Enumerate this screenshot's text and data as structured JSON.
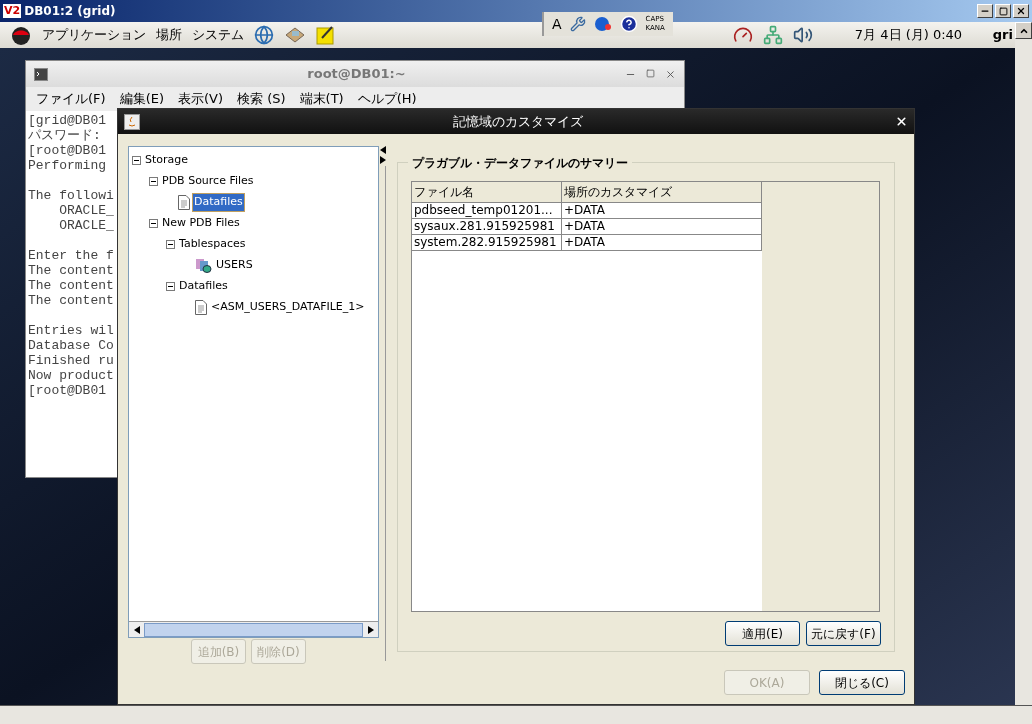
{
  "vnc_window": {
    "title": "DB01:2 (grid)",
    "logo": "V2"
  },
  "panel": {
    "menus": [
      "アプリケーション",
      "場所",
      "システム"
    ],
    "ime": {
      "letter": "A",
      "caps": "CAPS",
      "kana": "KANA"
    },
    "clock": "7月 4日 (月) 0:40",
    "user": "gri"
  },
  "terminal": {
    "title": "root@DB01:~",
    "menus": [
      "ファイル(F)",
      "編集(E)",
      "表示(V)",
      "検索 (S)",
      "端末(T)",
      "ヘルプ(H)"
    ],
    "blocks": [
      [
        "[grid@DB01",
        "パスワード:",
        "[root@DB01",
        "Performing"
      ],
      [
        "The followi",
        "    ORACLE_",
        "    ORACLE_"
      ],
      [
        "Enter the f",
        "The content",
        "The content",
        "The content"
      ],
      [
        "Entries wil",
        "Database Co",
        "Finished ru",
        "Now product",
        "[root@DB01"
      ]
    ]
  },
  "dialog": {
    "title": "記憶域のカスタマイズ",
    "tree": [
      {
        "label": "Storage",
        "expanded": true,
        "selected": false,
        "children": [
          {
            "label": "PDB Source Files",
            "expanded": true,
            "selected": false,
            "children": [
              {
                "label": "Datafiles",
                "kind": "file",
                "selected": true
              }
            ]
          },
          {
            "label": "New PDB Files",
            "expanded": true,
            "selected": false,
            "children": [
              {
                "label": "Tablespaces",
                "expanded": true,
                "selected": false,
                "children": [
                  {
                    "label": "USERS",
                    "kind": "tablespace",
                    "selected": false
                  }
                ]
              },
              {
                "label": "Datafiles",
                "expanded": true,
                "selected": false,
                "children": [
                  {
                    "label": "<ASM_USERS_DATAFILE_1>",
                    "kind": "file",
                    "selected": false
                  }
                ]
              }
            ]
          }
        ]
      }
    ],
    "tree_buttons": [
      {
        "label": "追加(B)",
        "disabled": true
      },
      {
        "label": "削除(D)",
        "disabled": true
      }
    ],
    "group_title": "プラガブル・データファイルのサマリー",
    "table": {
      "columns": [
        "ファイル名",
        "場所のカスタマイズ"
      ],
      "rows": [
        [
          "pdbseed_temp01201...",
          "+DATA"
        ],
        [
          "sysaux.281.915925981",
          "+DATA"
        ],
        [
          "system.282.915925981",
          "+DATA"
        ]
      ]
    },
    "group_buttons": [
      {
        "label": "適用(E)",
        "disabled": false
      },
      {
        "label": "元に戻す(F)",
        "disabled": false
      }
    ],
    "buttons": [
      {
        "label": "OK(A)",
        "disabled": true
      },
      {
        "label": "閉じる(C)",
        "disabled": false
      }
    ]
  }
}
